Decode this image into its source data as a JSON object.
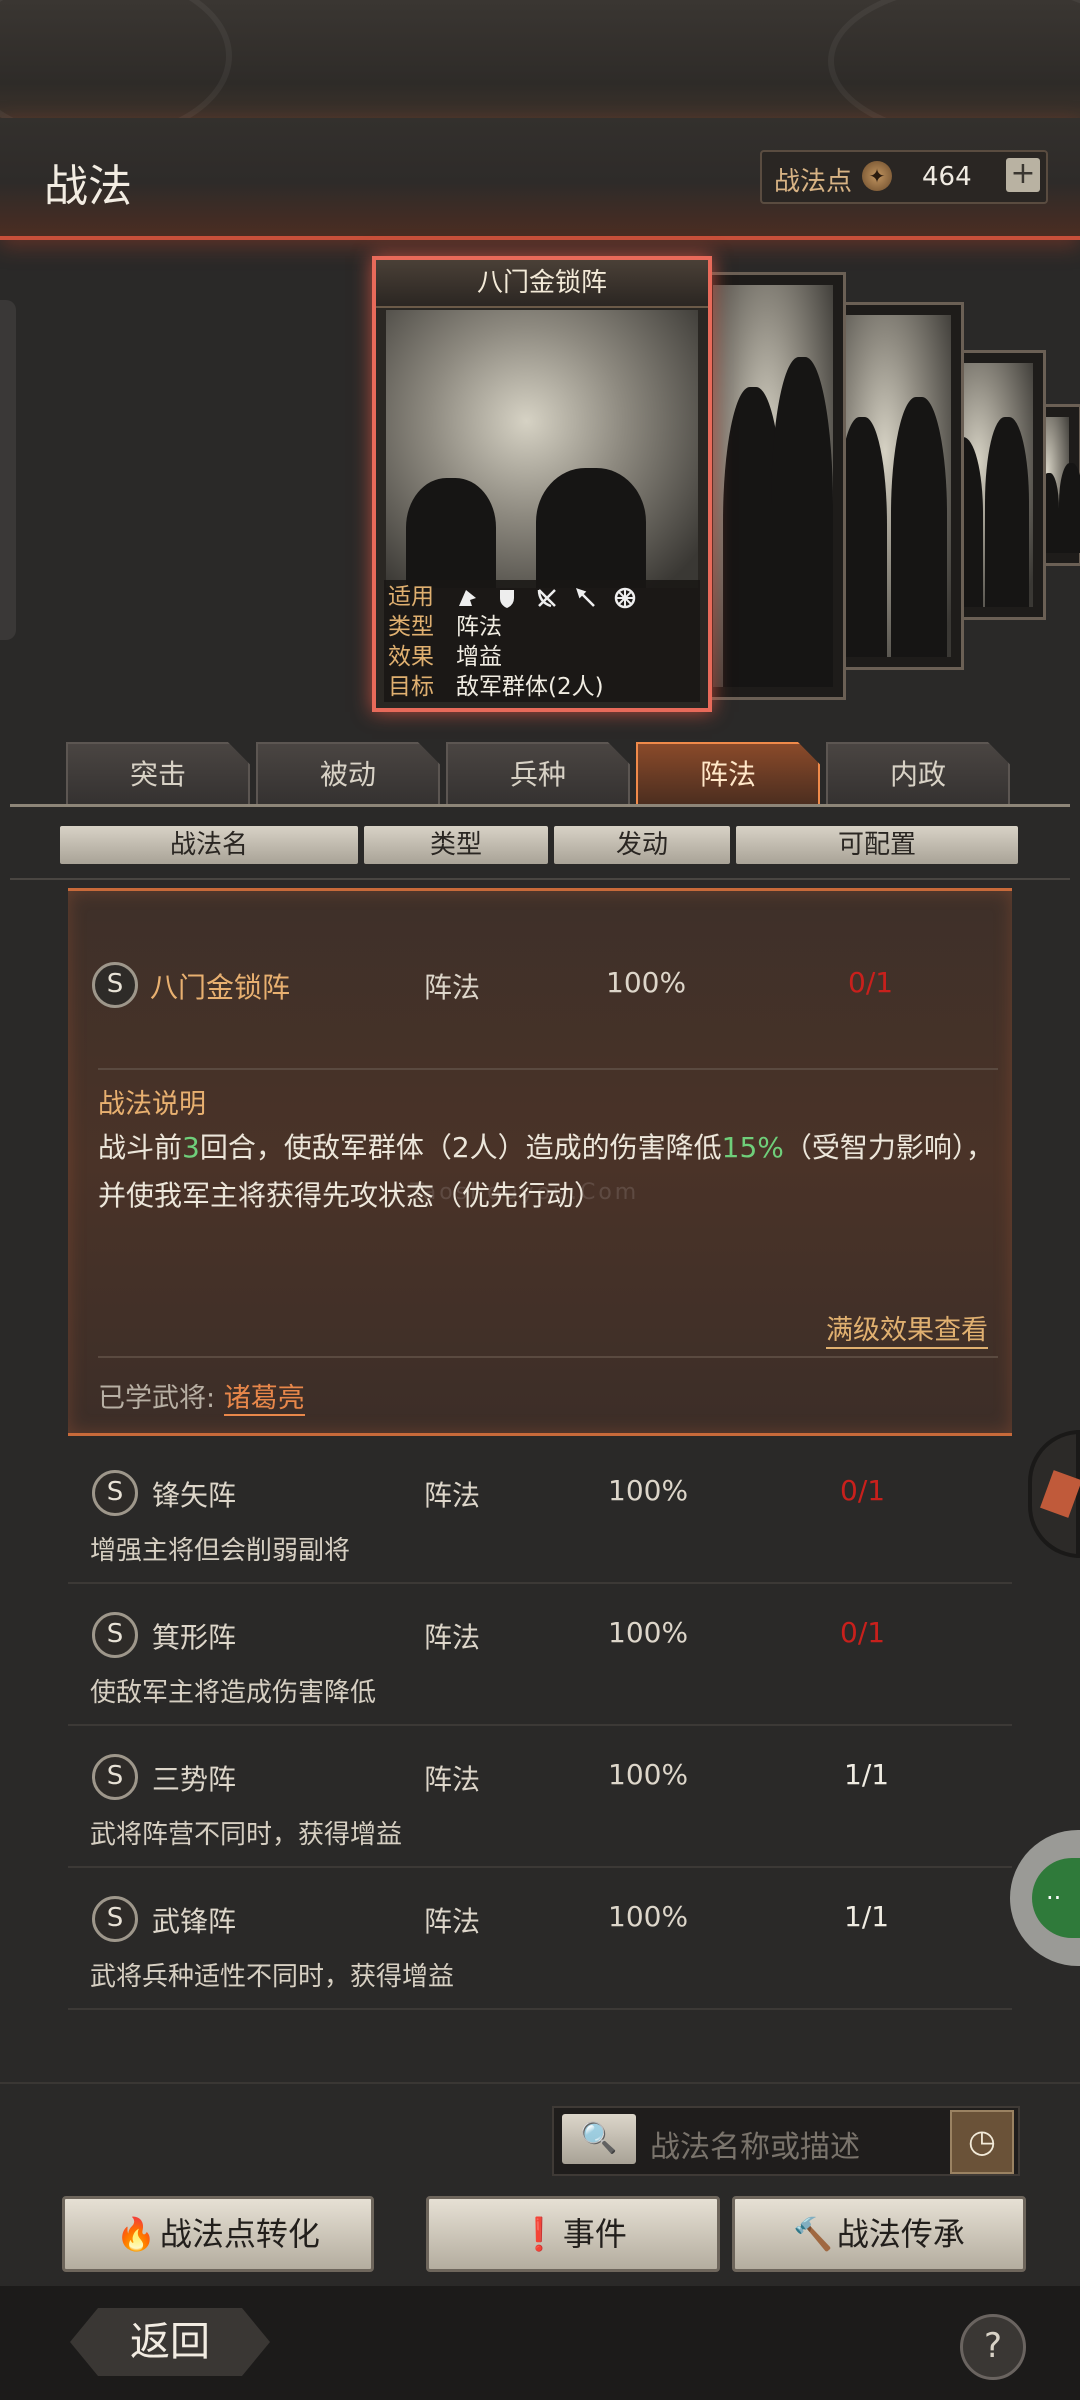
{
  "header": {
    "title": "战法",
    "points_label": "战法点",
    "points_value": "464",
    "plus": "+"
  },
  "card": {
    "name": "八门金锁阵",
    "rows": [
      {
        "key": "适用",
        "value": ""
      },
      {
        "key": "类型",
        "value": "阵法"
      },
      {
        "key": "效果",
        "value": "增益"
      },
      {
        "key": "目标",
        "value": "敌军群体(2人)"
      }
    ],
    "unit_icons": [
      "cavalry-icon",
      "shield-icon",
      "bow-icon",
      "spear-icon",
      "wheel-icon"
    ]
  },
  "tabs": [
    "突击",
    "被动",
    "兵种",
    "阵法",
    "内政"
  ],
  "active_tab": "阵法",
  "columns": [
    "战法名",
    "类型",
    "发动",
    "可配置"
  ],
  "selected": {
    "grade": "S",
    "name": "八门金锁阵",
    "type": "阵法",
    "rate": "100%",
    "config": "0/1",
    "desc_title": "战法说明",
    "desc_1": "战斗前",
    "desc_n": "3",
    "desc_2": "回合，使敌军群体（2人）造成的伤害降低",
    "desc_pct": "15%",
    "desc_3": "（受智力影响），并使我军主将获得先攻状态（优先行动）",
    "full_link": "满级效果查看",
    "learned_label": "已学武将:",
    "learned_name": "诸葛亮"
  },
  "rows": [
    {
      "grade": "S",
      "name": "锋矢阵",
      "type": "阵法",
      "rate": "100%",
      "config": "0/1",
      "desc": "增强主将但会削弱副将",
      "config_color": "#c8201c"
    },
    {
      "grade": "S",
      "name": "箕形阵",
      "type": "阵法",
      "rate": "100%",
      "config": "0/1",
      "desc": "使敌军主将造成伤害降低",
      "config_color": "#c8201c"
    },
    {
      "grade": "S",
      "name": "三势阵",
      "type": "阵法",
      "rate": "100%",
      "config": "1/1",
      "desc": "武将阵营不同时，获得增益",
      "config_color": "#f0ece2"
    },
    {
      "grade": "S",
      "name": "武锋阵",
      "type": "阵法",
      "rate": "100%",
      "config": "1/1",
      "desc": "武将兵种适性不同时，获得增益",
      "config_color": "#f0ece2"
    }
  ],
  "watermark": "Taoshouyou.Com",
  "search": {
    "placeholder": "战法名称或描述"
  },
  "buttons": {
    "convert": "战法点转化",
    "event": "事件",
    "inherit": "战法传承"
  },
  "footer": {
    "back": "返回",
    "help": "?"
  },
  "colors": {
    "accent": "#e86a5a",
    "active_tab": "#f08a4a",
    "red": "#c8201c",
    "green": "#6fcf7a",
    "gold": "#e0b070"
  }
}
